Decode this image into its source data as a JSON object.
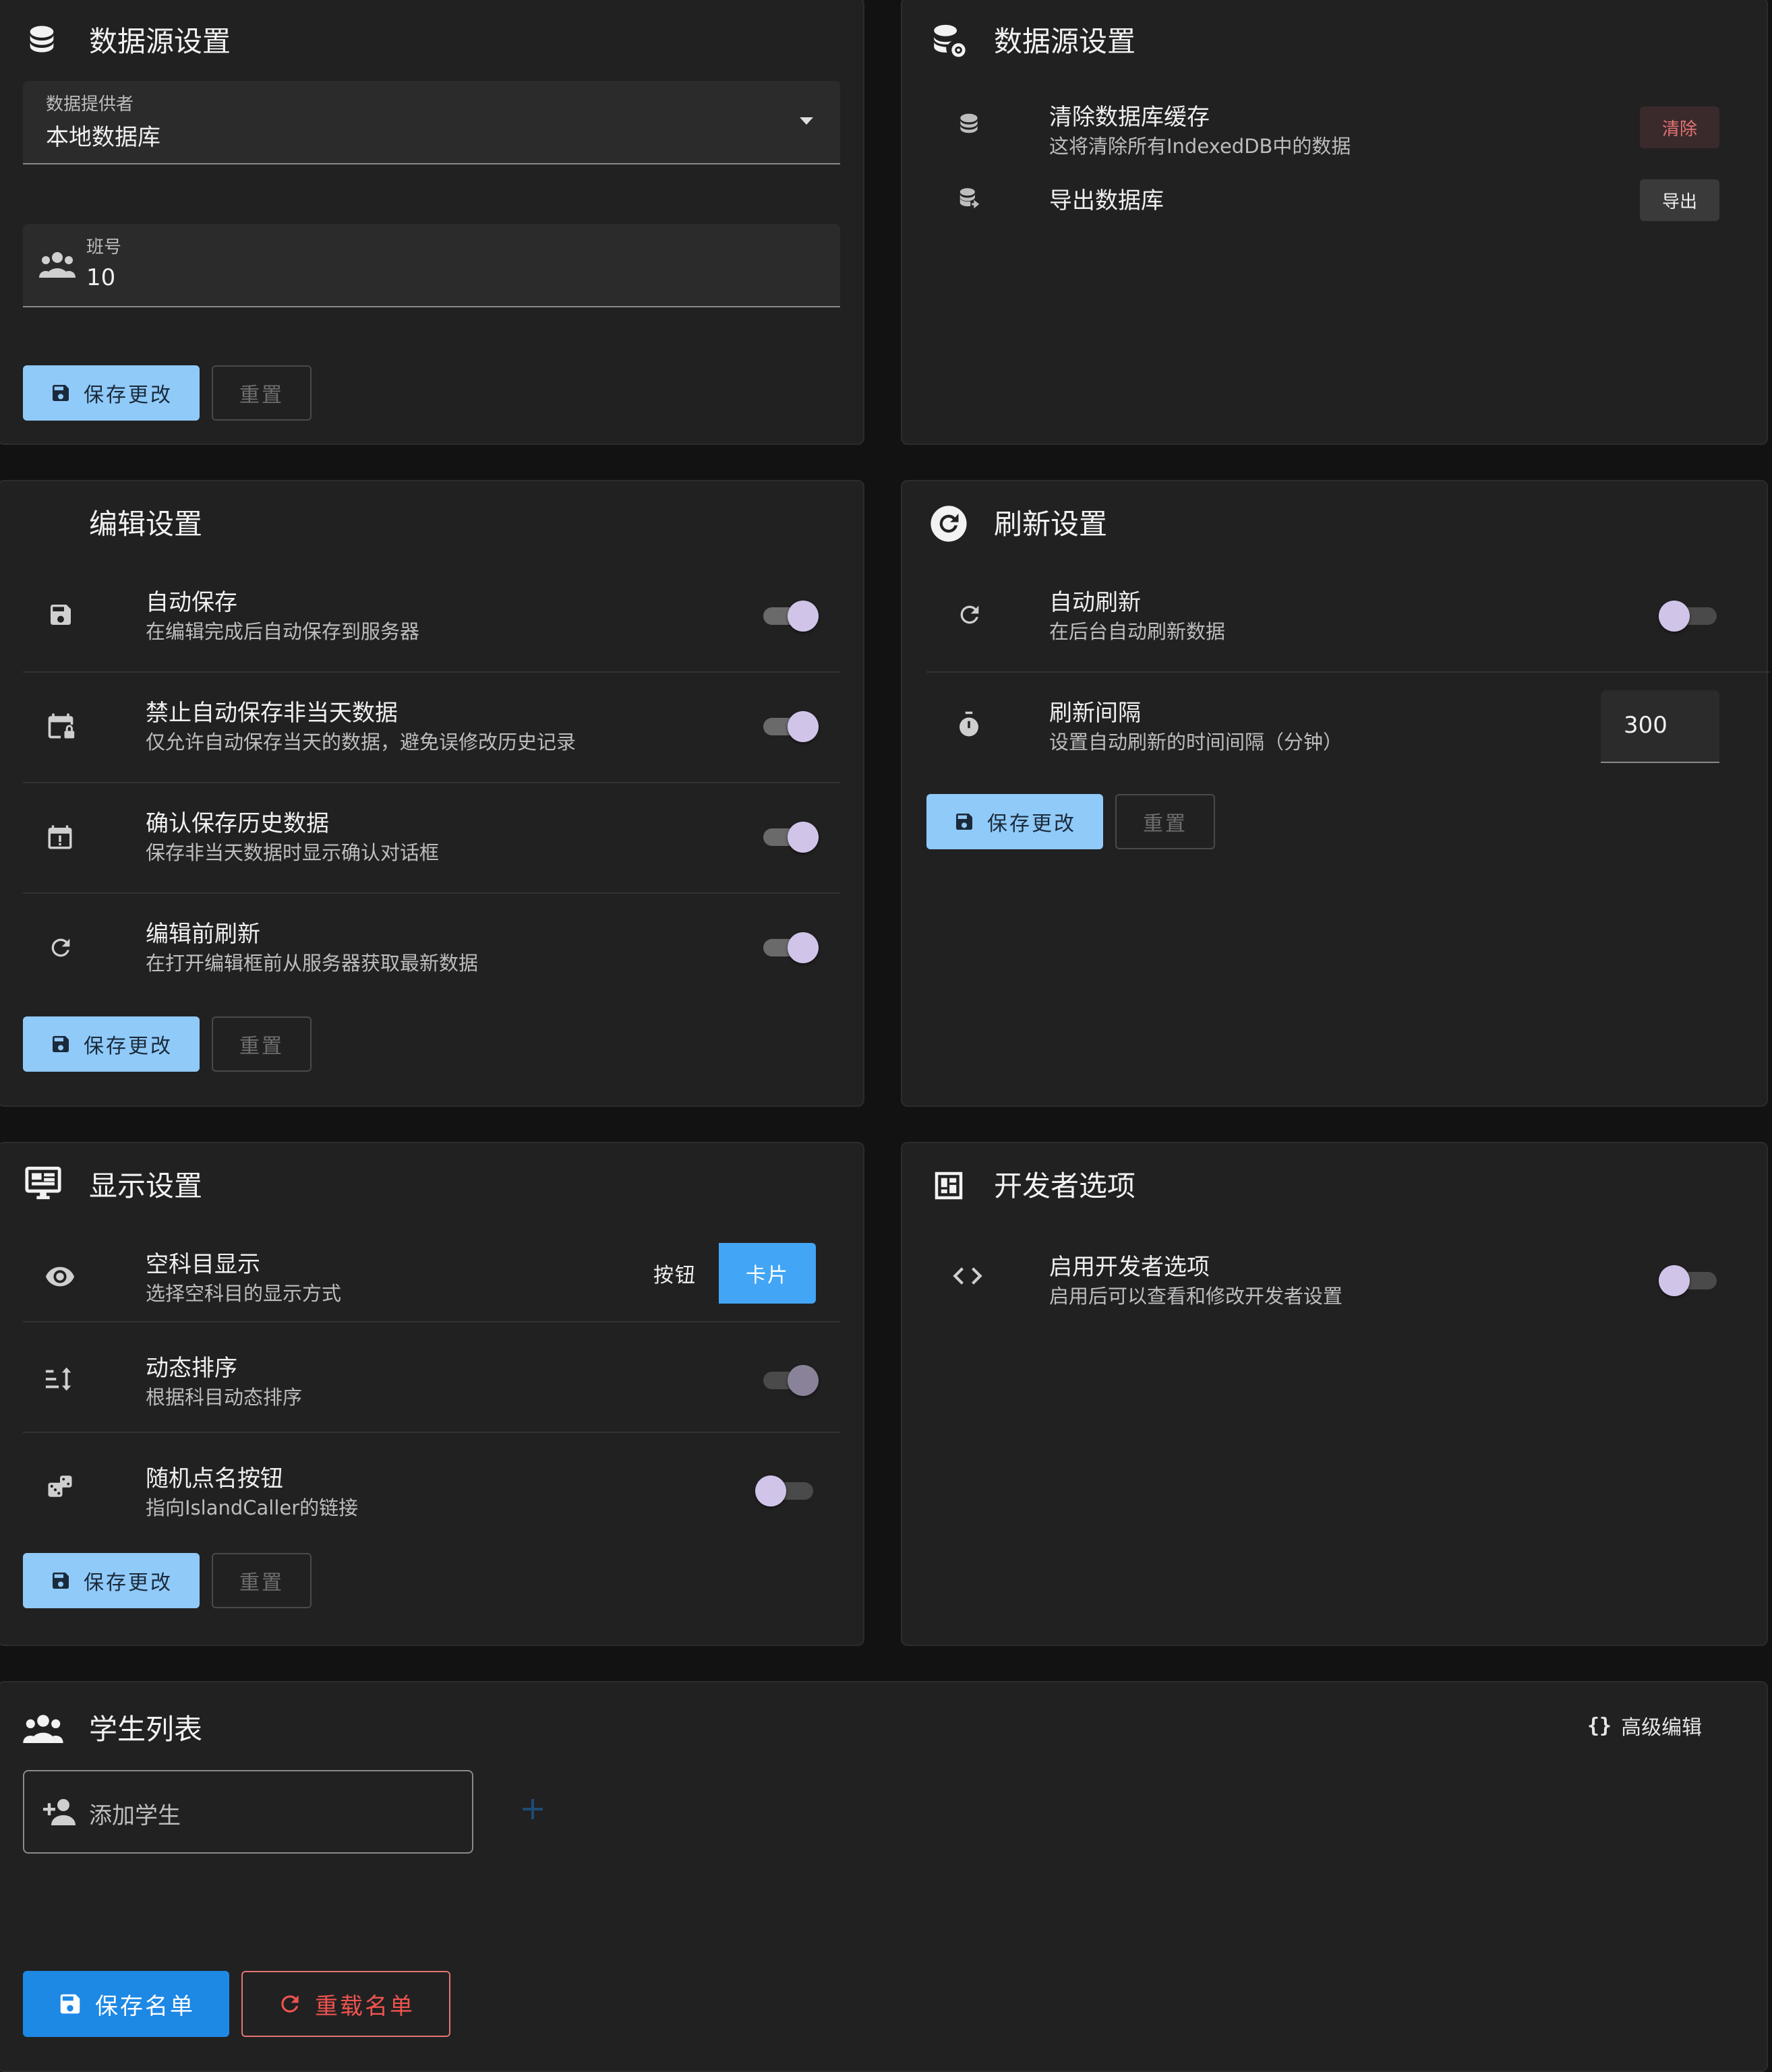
{
  "colors": {
    "background": "#121212",
    "card": "#212121",
    "primary": "#90caf9",
    "accent_blue": "#42a5f5",
    "danger": "#ef5350",
    "switch_thumb": "#d1c4e9"
  },
  "datasource": {
    "title": "数据源设置",
    "title_icon": "database-icon",
    "provider": {
      "label": "数据提供者",
      "value": "本地数据库"
    },
    "class_no": {
      "label": "班号",
      "value": "10"
    },
    "save_label": "保存更改",
    "reset_label": "重置"
  },
  "datasource_actions": {
    "title": "数据源设置",
    "title_icon": "database-cog-icon",
    "clear": {
      "title": "清除数据库缓存",
      "subtitle": "这将清除所有IndexedDB中的数据",
      "button": "清除"
    },
    "export": {
      "title": "导出数据库",
      "button": "导出"
    }
  },
  "edit": {
    "title": "编辑设置",
    "items": [
      {
        "title": "自动保存",
        "subtitle": "在编辑完成后自动保存到服务器",
        "icon": "save-icon",
        "enabled": true
      },
      {
        "title": "禁止自动保存非当天数据",
        "subtitle": "仅允许自动保存当天的数据，避免误修改历史记录",
        "icon": "calendar-lock-icon",
        "enabled": true
      },
      {
        "title": "确认保存历史数据",
        "subtitle": "保存非当天数据时显示确认对话框",
        "icon": "calendar-alert-icon",
        "enabled": true
      },
      {
        "title": "编辑前刷新",
        "subtitle": "在打开编辑框前从服务器获取最新数据",
        "icon": "refresh-icon",
        "enabled": true
      }
    ],
    "save_label": "保存更改",
    "reset_label": "重置"
  },
  "refresh": {
    "title": "刷新设置",
    "auto": {
      "title": "自动刷新",
      "subtitle": "在后台自动刷新数据",
      "enabled": false
    },
    "interval": {
      "title": "刷新间隔",
      "subtitle": "设置自动刷新的时间间隔（分钟）",
      "value": "300"
    },
    "save_label": "保存更改",
    "reset_label": "重置"
  },
  "display": {
    "title": "显示设置",
    "empty_subject": {
      "title": "空科目显示",
      "subtitle": "选择空科目的显示方式",
      "options": [
        "按钮",
        "卡片"
      ],
      "selected": "卡片"
    },
    "dynamic_sort": {
      "title": "动态排序",
      "subtitle": "根据科目动态排序",
      "enabled": true
    },
    "random_call": {
      "title": "随机点名按钮",
      "subtitle": "指向IslandCaller的链接",
      "enabled": false
    },
    "save_label": "保存更改",
    "reset_label": "重置"
  },
  "developer": {
    "title": "开发者选项",
    "enable": {
      "title": "启用开发者选项",
      "subtitle": "启用后可以查看和修改开发者设置",
      "enabled": false
    }
  },
  "students": {
    "title": "学生列表",
    "advanced_edit": "高级编辑",
    "add_placeholder": "添加学生",
    "save_list": "保存名单",
    "reload_list": "重载名单"
  }
}
